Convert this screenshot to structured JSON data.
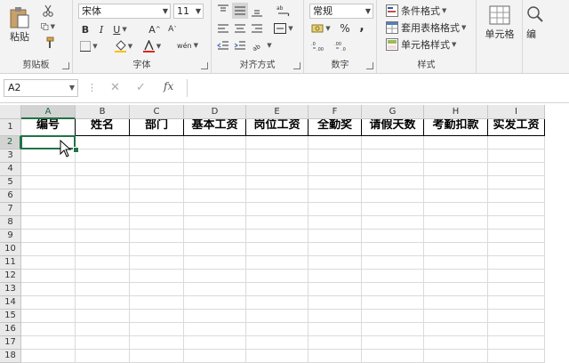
{
  "ribbon": {
    "clipboard": {
      "label": "剪贴板",
      "paste": "粘贴"
    },
    "font": {
      "label": "字体",
      "font_name": "宋体",
      "font_size": "11",
      "bold": "B",
      "italic": "I",
      "underline": "U",
      "grow": "A",
      "shrink": "A",
      "phonetic": "wén"
    },
    "alignment": {
      "label": "对齐方式"
    },
    "number": {
      "label": "数字",
      "format": "常规",
      "percent": "%",
      "comma": ","
    },
    "styles": {
      "label": "样式",
      "conditional": "条件格式",
      "table": "套用表格格式",
      "cell_styles": "单元格样式"
    },
    "cells": {
      "label": "单元格"
    },
    "edit": {
      "label": "编"
    }
  },
  "formula_bar": {
    "name_box": "A2",
    "value": ""
  },
  "columns": [
    "A",
    "B",
    "C",
    "D",
    "E",
    "F",
    "G",
    "H",
    "I"
  ],
  "rows": [
    "1",
    "2",
    "3",
    "4",
    "5",
    "6",
    "7",
    "8",
    "9",
    "10",
    "11",
    "12",
    "13",
    "14",
    "15",
    "16",
    "17",
    "18"
  ],
  "headers": [
    "编号",
    "姓名",
    "部门",
    "基本工资",
    "岗位工资",
    "全勤奖",
    "请假天数",
    "考勤扣款",
    "实发工资"
  ]
}
